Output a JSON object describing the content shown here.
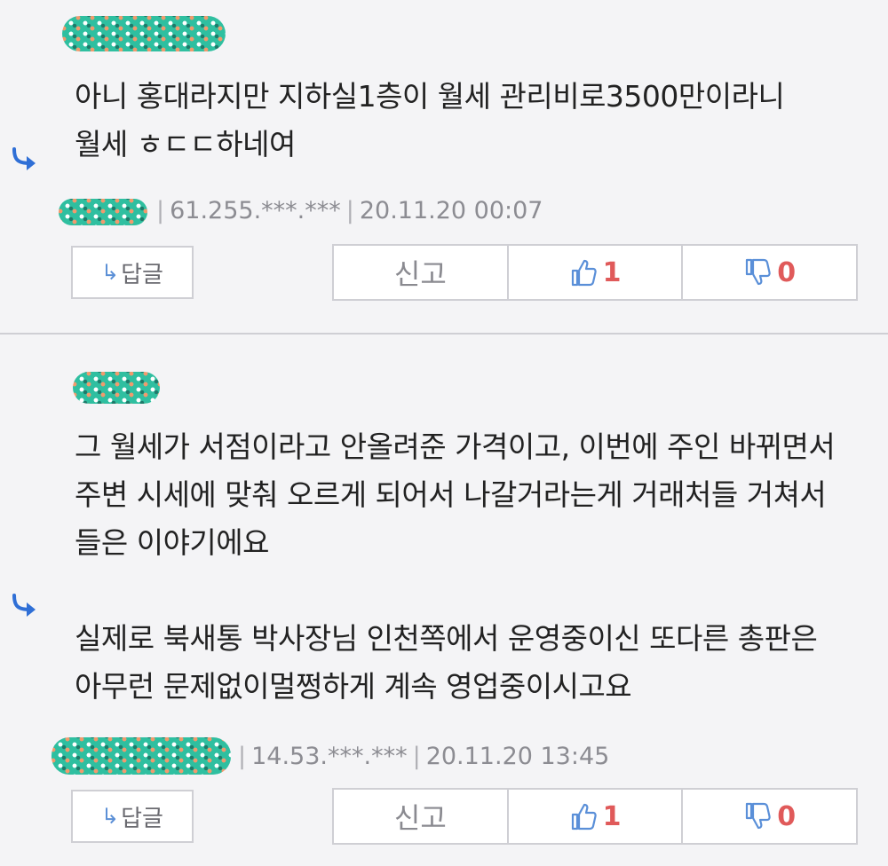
{
  "comments": [
    {
      "body": "아니 홍대라지만 지하실1층이 월세 관리비로3500만이라니\n월세 ㅎㄷㄷ하네여",
      "ip": "61.255.***.***",
      "date": "20.11.20 00:07",
      "reply_label": "답글",
      "report_label": "신고",
      "likes": "1",
      "dislikes": "0"
    },
    {
      "body": "그 월세가 서점이라고 안올려준 가격이고, 이번에 주인 바뀌면서 주변 시세에 맞춰 오르게 되어서 나갈거라는게 거래처들 거쳐서 들은 이야기에요\n\n실제로 북새통 박사장님 인천쪽에서 운영중이신 또다른 총판은 아무런 문제없이멀쩡하게 계속 영업중이시고요",
      "ip": "14.53.***.***",
      "date": "20.11.20 13:45",
      "reply_label": "답글",
      "report_label": "신고",
      "likes": "1",
      "dislikes": "0"
    }
  ],
  "colors": {
    "accent_blue": "#2f6fd6",
    "count_red": "#e05a5a",
    "nick_blob": "#2fbfa0"
  },
  "icons": [
    "reply-arrow-icon",
    "thumbs-up-icon",
    "thumbs-down-icon"
  ]
}
